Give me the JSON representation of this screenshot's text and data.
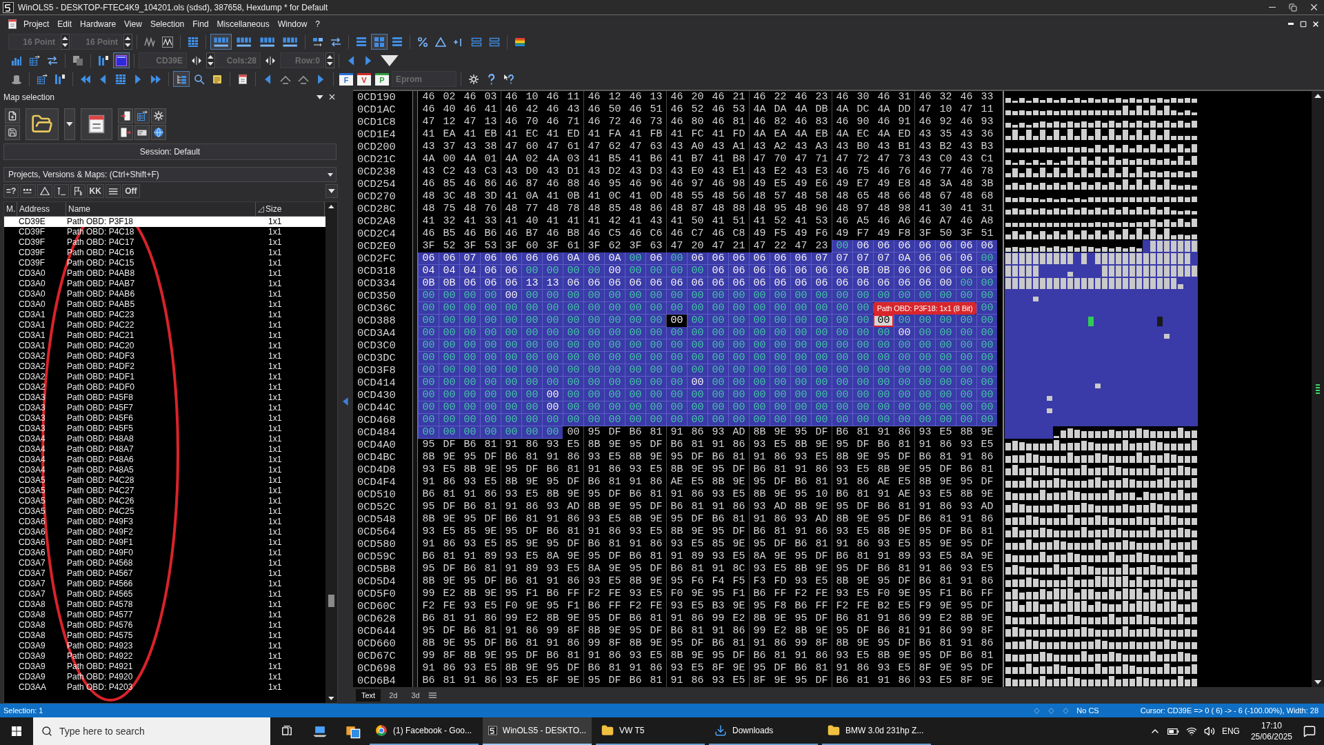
{
  "window": {
    "title": "WinOLS5 - DESKTOP-FTEC4K9_104201.ols (sdsd), 387658, Hexdump * for Default"
  },
  "menu": [
    "Project",
    "Edit",
    "Hardware",
    "View",
    "Selection",
    "Find",
    "Miscellaneous",
    "Window",
    "?"
  ],
  "toolbars": [
    [
      {
        "kind": "field",
        "value": "16 Point",
        "disabled": true
      },
      {
        "kind": "spin"
      },
      {
        "kind": "field",
        "value": "16 Point",
        "disabled": true
      },
      {
        "kind": "spin"
      },
      {
        "kind": "separator"
      },
      {
        "kind": "button",
        "pressed": false
      },
      {
        "kind": "button",
        "pressed": false
      },
      {
        "kind": "separator"
      },
      {
        "kind": "button",
        "pressed": false
      },
      {
        "kind": "separator"
      },
      {
        "kind": "button",
        "pressed": true
      },
      {
        "kind": "button",
        "pressed": false
      },
      {
        "kind": "button",
        "pressed": false
      },
      {
        "kind": "button",
        "pressed": false
      },
      {
        "kind": "separator"
      },
      {
        "kind": "button",
        "pressed": false
      },
      {
        "kind": "button",
        "pressed": false
      },
      {
        "kind": "separator"
      },
      {
        "kind": "button",
        "pressed": false
      },
      {
        "kind": "button",
        "pressed": true
      },
      {
        "kind": "button",
        "pressed": false
      },
      {
        "kind": "separator"
      },
      {
        "kind": "button",
        "pressed": false
      },
      {
        "kind": "button",
        "pressed": false
      },
      {
        "kind": "button",
        "pressed": false
      },
      {
        "kind": "button",
        "pressed": false
      },
      {
        "kind": "button",
        "pressed": false
      },
      {
        "kind": "separator"
      },
      {
        "kind": "button",
        "pressed": false
      }
    ],
    [
      {
        "kind": "button",
        "pressed": false
      },
      {
        "kind": "button",
        "pressed": false
      },
      {
        "kind": "button",
        "pressed": false
      },
      {
        "kind": "separator"
      },
      {
        "kind": "button",
        "pressed": false
      },
      {
        "kind": "separator"
      },
      {
        "kind": "button",
        "pressed": false
      },
      {
        "kind": "button",
        "pressed": true
      },
      {
        "kind": "separator"
      },
      {
        "kind": "field",
        "value": "CD39E",
        "disabled": true
      },
      {
        "kind": "button",
        "pressed": false
      },
      {
        "kind": "spin"
      },
      {
        "kind": "field",
        "value": "Cols:28",
        "disabled": true
      },
      {
        "kind": "button",
        "pressed": false
      },
      {
        "kind": "field",
        "value": "Row:0",
        "disabled": true
      },
      {
        "kind": "spin"
      },
      {
        "kind": "separator"
      },
      {
        "kind": "button",
        "pressed": false
      },
      {
        "kind": "button",
        "pressed": false
      },
      {
        "kind": "button",
        "pressed": false
      }
    ],
    [
      {
        "kind": "button",
        "pressed": false
      },
      {
        "kind": "separator"
      },
      {
        "kind": "button",
        "pressed": false
      },
      {
        "kind": "button",
        "pressed": false
      },
      {
        "kind": "separator"
      },
      {
        "kind": "button",
        "pressed": false
      },
      {
        "kind": "button",
        "pressed": false
      },
      {
        "kind": "button",
        "pressed": false
      },
      {
        "kind": "button",
        "pressed": false
      },
      {
        "kind": "button",
        "pressed": false
      },
      {
        "kind": "separator"
      },
      {
        "kind": "button",
        "pressed": true
      },
      {
        "kind": "button",
        "pressed": false
      },
      {
        "kind": "button",
        "pressed": false
      },
      {
        "kind": "separator"
      },
      {
        "kind": "button",
        "pressed": false
      },
      {
        "kind": "separator"
      },
      {
        "kind": "button",
        "pressed": false
      },
      {
        "kind": "button",
        "pressed": false
      },
      {
        "kind": "button",
        "pressed": false
      },
      {
        "kind": "button",
        "pressed": false
      },
      {
        "kind": "separator"
      },
      {
        "kind": "letter",
        "label": "F",
        "color": "#2a6fd6"
      },
      {
        "kind": "letter",
        "label": "V",
        "color": "#d42a2a"
      },
      {
        "kind": "letter",
        "label": "P",
        "color": "#2e9e3e"
      },
      {
        "kind": "field",
        "value": "Eprom",
        "disabled": true
      },
      {
        "kind": "separator"
      },
      {
        "kind": "button",
        "pressed": false
      },
      {
        "kind": "button",
        "pressed": false
      },
      {
        "kind": "button",
        "pressed": false
      }
    ]
  ],
  "map_selection": {
    "title": "Map selection",
    "session": "Session: Default",
    "filter": "Projects, Versions & Maps: (Ctrl+Shift+F)",
    "filter_buttons": [
      {
        "kind": "text",
        "label": "=?"
      },
      {
        "kind": "icon"
      },
      {
        "kind": "icon"
      },
      {
        "kind": "icon"
      },
      {
        "kind": "icon"
      },
      {
        "kind": "text",
        "label": "KK"
      },
      {
        "kind": "icon"
      },
      {
        "kind": "text",
        "label": "Off"
      }
    ],
    "columns": [
      {
        "label": "M.",
        "sorted": false
      },
      {
        "label": "Address",
        "sorted": false
      },
      {
        "label": "Name",
        "sorted": false
      },
      {
        "label": "Size",
        "sorted": true
      }
    ],
    "rows": [
      {
        "address": "CD39E",
        "name": "Path OBD: P3F18",
        "size": "1x1",
        "selected": true
      },
      {
        "address": "CD39F",
        "name": "Path OBD: P4C18",
        "size": "1x1",
        "selected": false
      },
      {
        "address": "CD39F",
        "name": "Path OBD: P4C17",
        "size": "1x1",
        "selected": false
      },
      {
        "address": "CD39F",
        "name": "Path OBD: P4C16",
        "size": "1x1",
        "selected": false
      },
      {
        "address": "CD39F",
        "name": "Path OBD: P4C15",
        "size": "1x1",
        "selected": false
      },
      {
        "address": "CD3A0",
        "name": "Path OBD: P4AB8",
        "size": "1x1",
        "selected": false
      },
      {
        "address": "CD3A0",
        "name": "Path OBD: P4AB7",
        "size": "1x1",
        "selected": false
      },
      {
        "address": "CD3A0",
        "name": "Path OBD: P4AB6",
        "size": "1x1",
        "selected": false
      },
      {
        "address": "CD3A0",
        "name": "Path OBD: P4AB5",
        "size": "1x1",
        "selected": false
      },
      {
        "address": "CD3A1",
        "name": "Path OBD: P4C23",
        "size": "1x1",
        "selected": false
      },
      {
        "address": "CD3A1",
        "name": "Path OBD: P4C22",
        "size": "1x1",
        "selected": false
      },
      {
        "address": "CD3A1",
        "name": "Path OBD: P4C21",
        "size": "1x1",
        "selected": false
      },
      {
        "address": "CD3A1",
        "name": "Path OBD: P4C20",
        "size": "1x1",
        "selected": false
      },
      {
        "address": "CD3A2",
        "name": "Path OBD: P4DF3",
        "size": "1x1",
        "selected": false
      },
      {
        "address": "CD3A2",
        "name": "Path OBD: P4DF2",
        "size": "1x1",
        "selected": false
      },
      {
        "address": "CD3A2",
        "name": "Path OBD: P4DF1",
        "size": "1x1",
        "selected": false
      },
      {
        "address": "CD3A2",
        "name": "Path OBD: P4DF0",
        "size": "1x1",
        "selected": false
      },
      {
        "address": "CD3A3",
        "name": "Path OBD: P45F8",
        "size": "1x1",
        "selected": false
      },
      {
        "address": "CD3A3",
        "name": "Path OBD: P45F7",
        "size": "1x1",
        "selected": false
      },
      {
        "address": "CD3A3",
        "name": "Path OBD: P45F6",
        "size": "1x1",
        "selected": false
      },
      {
        "address": "CD3A3",
        "name": "Path OBD: P45F5",
        "size": "1x1",
        "selected": false
      },
      {
        "address": "CD3A4",
        "name": "Path OBD: P48A8",
        "size": "1x1",
        "selected": false
      },
      {
        "address": "CD3A4",
        "name": "Path OBD: P48A7",
        "size": "1x1",
        "selected": false
      },
      {
        "address": "CD3A4",
        "name": "Path OBD: P48A6",
        "size": "1x1",
        "selected": false
      },
      {
        "address": "CD3A4",
        "name": "Path OBD: P48A5",
        "size": "1x1",
        "selected": false
      },
      {
        "address": "CD3A5",
        "name": "Path OBD: P4C28",
        "size": "1x1",
        "selected": false
      },
      {
        "address": "CD3A5",
        "name": "Path OBD: P4C27",
        "size": "1x1",
        "selected": false
      },
      {
        "address": "CD3A5",
        "name": "Path OBD: P4C26",
        "size": "1x1",
        "selected": false
      },
      {
        "address": "CD3A5",
        "name": "Path OBD: P4C25",
        "size": "1x1",
        "selected": false
      },
      {
        "address": "CD3A6",
        "name": "Path OBD: P49F3",
        "size": "1x1",
        "selected": false
      },
      {
        "address": "CD3A6",
        "name": "Path OBD: P49F2",
        "size": "1x1",
        "selected": false
      },
      {
        "address": "CD3A6",
        "name": "Path OBD: P49F1",
        "size": "1x1",
        "selected": false
      },
      {
        "address": "CD3A6",
        "name": "Path OBD: P49F0",
        "size": "1x1",
        "selected": false
      },
      {
        "address": "CD3A7",
        "name": "Path OBD: P4568",
        "size": "1x1",
        "selected": false
      },
      {
        "address": "CD3A7",
        "name": "Path OBD: P4567",
        "size": "1x1",
        "selected": false
      },
      {
        "address": "CD3A7",
        "name": "Path OBD: P4566",
        "size": "1x1",
        "selected": false
      },
      {
        "address": "CD3A7",
        "name": "Path OBD: P4565",
        "size": "1x1",
        "selected": false
      },
      {
        "address": "CD3A8",
        "name": "Path OBD: P4578",
        "size": "1x1",
        "selected": false
      },
      {
        "address": "CD3A8",
        "name": "Path OBD: P4577",
        "size": "1x1",
        "selected": false
      },
      {
        "address": "CD3A8",
        "name": "Path OBD: P4576",
        "size": "1x1",
        "selected": false
      },
      {
        "address": "CD3A8",
        "name": "Path OBD: P4575",
        "size": "1x1",
        "selected": false
      },
      {
        "address": "CD3A9",
        "name": "Path OBD: P4923",
        "size": "1x1",
        "selected": false
      },
      {
        "address": "CD3A9",
        "name": "Path OBD: P4922",
        "size": "1x1",
        "selected": false
      },
      {
        "address": "CD3A9",
        "name": "Path OBD: P4921",
        "size": "1x1",
        "selected": false
      },
      {
        "address": "CD3A9",
        "name": "Path OBD: P4920",
        "size": "1x1",
        "selected": false
      },
      {
        "address": "CD3AA",
        "name": "Path OBD: P4203",
        "size": "1x1",
        "selected": false
      }
    ]
  },
  "hexdump": {
    "rows": [
      {
        "address": "0CD190",
        "segments": [
          {
            "kind": "plain",
            "bytes": "46 02 46 03 46 10 46 11 46 12 46 13 46 20 46 21 46 22 46 23 46 30 46 31 46 32 46 33"
          }
        ]
      },
      {
        "address": "0CD1AC",
        "segments": [
          {
            "kind": "plain",
            "bytes": "46 40 46 41 46 42 46 43 46 50 46 51 46 52 46 53 4A DA 4A DB 4A DC 4A DD 47 10 47 11"
          }
        ]
      },
      {
        "address": "0CD1C8",
        "segments": [
          {
            "kind": "plain",
            "bytes": "47 12 47 13 46 70 46 71 46 72 46 73 46 80 46 81 46 82 46 83 46 90 46 91 46 92 46 93"
          }
        ]
      },
      {
        "address": "0CD1E4",
        "segments": [
          {
            "kind": "plain",
            "bytes": "41 EA 41 EB 41 EC 41 ED 41 FA 41 FB 41 FC 41 FD 4A EA 4A EB 4A EC 4A ED 43 35 43 36"
          }
        ]
      },
      {
        "address": "0CD200",
        "segments": [
          {
            "kind": "plain",
            "bytes": "43 37 43 38 47 60 47 61 47 62 47 63 43 A0 43 A1 43 A2 43 A3 43 B0 43 B1 43 B2 43 B3"
          }
        ]
      },
      {
        "address": "0CD21C",
        "segments": [
          {
            "kind": "plain",
            "bytes": "4A 00 4A 01 4A 02 4A 03 41 B5 41 B6 41 B7 41 B8 47 70 47 71 47 72 47 73 43 C0 43 C1"
          }
        ]
      },
      {
        "address": "0CD238",
        "segments": [
          {
            "kind": "plain",
            "bytes": "43 C2 43 C3 43 D0 43 D1 43 D2 43 D3 43 E0 43 E1 43 E2 43 E3 46 75 46 76 46 77 46 78"
          }
        ]
      },
      {
        "address": "0CD254",
        "segments": [
          {
            "kind": "plain",
            "bytes": "46 85 46 86 46 87 46 88 46 95 46 96 46 97 46 98 49 E5 49 E6 49 E7 49 E8 48 3A 48 3B"
          }
        ]
      },
      {
        "address": "0CD270",
        "segments": [
          {
            "kind": "plain",
            "bytes": "48 3C 48 3D 41 0A 41 0B 41 0C 41 0D 48 55 48 56 48 57 48 58 48 65 48 66 48 67 48 68"
          }
        ]
      },
      {
        "address": "0CD28C",
        "segments": [
          {
            "kind": "plain",
            "bytes": "48 75 48 76 48 77 48 78 48 85 48 86 48 87 48 88 48 95 48 96 48 97 48 98 41 30 41 31"
          }
        ]
      },
      {
        "address": "0CD2A8",
        "segments": [
          {
            "kind": "plain",
            "bytes": "41 32 41 33 41 40 41 41 41 42 41 43 41 50 41 51 41 52 41 53 46 A5 46 A6 46 A7 46 A8"
          }
        ]
      },
      {
        "address": "0CD2C4",
        "segments": [
          {
            "kind": "plain",
            "bytes": "46 B5 46 B6 46 B7 46 B8 46 C5 46 C6 46 C7 46 C8 49 F5 49 F6 49 F7 49 F8 3F 50 3F 51"
          }
        ]
      },
      {
        "address": "0CD2E0",
        "segments": [
          {
            "kind": "plain",
            "bytes": "3F 52 3F 53 3F 60 3F 61 3F 62 3F 63 47 20 47 21 47 22 47 23"
          },
          {
            "kind": "map-zero",
            "bytes": "00"
          },
          {
            "kind": "map",
            "bytes": "06 06 06 06 06 06 06"
          }
        ]
      },
      {
        "address": "0CD2FC",
        "segments": [
          {
            "kind": "map",
            "bytes": "06 06 07 06 06 06 06 0A 06 0A"
          },
          {
            "kind": "map-zero",
            "bytes": "00"
          },
          {
            "kind": "map",
            "bytes": "06"
          },
          {
            "kind": "map-zero",
            "bytes": "00"
          },
          {
            "kind": "map",
            "bytes": "06 06 06 06 06 06 07 07 07 07 0A 06 06 06"
          },
          {
            "kind": "map-zero",
            "bytes": "00"
          }
        ]
      },
      {
        "address": "0CD318",
        "segments": [
          {
            "kind": "map",
            "bytes": "04 04 04 06 06"
          },
          {
            "kind": "map-zero",
            "bytes": "00 00 00 00"
          },
          {
            "kind": "map",
            "bytes": "00"
          },
          {
            "kind": "map-zero",
            "bytes": "00 00 00 00"
          },
          {
            "kind": "map",
            "bytes": "06 06 06 06 06 06 06 0B 0B 06 06 06 06 06"
          }
        ]
      },
      {
        "address": "0CD334",
        "segments": [
          {
            "kind": "map",
            "bytes": "0B 0B 06 06 06 13 13 06 06 06 06 06 06 06 06 06 06 06 06 06 06 06 06 06 06 00"
          },
          {
            "kind": "map-zero",
            "bytes": "00 00"
          }
        ]
      },
      {
        "address": "0CD350",
        "segments": [
          {
            "kind": "map-zero",
            "bytes": "00 00 00 00"
          },
          {
            "kind": "map",
            "bytes": "00"
          },
          {
            "kind": "map-zero",
            "bytes": "00 00 00 00 00 00 00 00 00 00 00 00 00 00 00 00 00 00 00 00 00 00 00"
          }
        ]
      },
      {
        "address": "0CD36C",
        "segments": [
          {
            "kind": "map-zero",
            "bytes": "00 00 00 00 00 00 00 00 00 00 00 00 00 00 00 00 00 00 00 00 00 00"
          },
          {
            "kind": "tooltip",
            "text": "Path OBD: P3F18: 1x1 (8 Bit)"
          },
          {
            "kind": "map-zero",
            "bytes": "00"
          }
        ]
      },
      {
        "address": "0CD388",
        "segments": [
          {
            "kind": "map-zero",
            "bytes": "00 00 00 00 00 00 00 00 00 00 00 00"
          },
          {
            "kind": "marked",
            "bytes": "00"
          },
          {
            "kind": "map-zero",
            "bytes": "00 00 00 00 00 00 00 00 00"
          },
          {
            "kind": "cursor",
            "bytes": "00"
          },
          {
            "kind": "map-zero",
            "bytes": "00 00 00 00 00"
          }
        ]
      },
      {
        "address": "0CD3A4",
        "segments": [
          {
            "kind": "map-zero",
            "bytes": "00 00 00 00 00 00 00 00 00 00 00 00 00 00 00 00 00 00 00 00 00 00 00"
          },
          {
            "kind": "map",
            "bytes": "00"
          },
          {
            "kind": "map-zero",
            "bytes": "00 00 00 00"
          }
        ]
      },
      {
        "address": "0CD3C0",
        "segments": [
          {
            "kind": "map-zero",
            "bytes": "00 00 00 00 00 00 00 00 00 00 00 00 00 00 00 00 00 00 00 00 00 00 00 00 00 00 00 00"
          }
        ]
      },
      {
        "address": "0CD3DC",
        "segments": [
          {
            "kind": "map-zero",
            "bytes": "00 00 00 00 00 00 00 00 00 00 00 00 00 00 00 00 00 00 00 00 00 00 00 00 00 00 00 00"
          }
        ]
      },
      {
        "address": "0CD3F8",
        "segments": [
          {
            "kind": "map-zero",
            "bytes": "00 00 00 00 00 00 00 00 00 00 00 00 00 00 00 00 00 00 00 00 00 00 00 00 00 00 00 00"
          }
        ]
      },
      {
        "address": "0CD414",
        "segments": [
          {
            "kind": "map-zero",
            "bytes": "00 00 00 00 00 00 00 00 00 00 00 00 00"
          },
          {
            "kind": "map",
            "bytes": "00"
          },
          {
            "kind": "map-zero",
            "bytes": "00 00 00 00 00 00 00 00 00 00 00 00 00 00"
          }
        ]
      },
      {
        "address": "0CD430",
        "segments": [
          {
            "kind": "map-zero",
            "bytes": "00 00 00 00 00 00"
          },
          {
            "kind": "map",
            "bytes": "00"
          },
          {
            "kind": "map-zero",
            "bytes": "00 00 00 00 00 00 00 00 00 00 00 00 00 00 00 00 00 00 00 00 00"
          }
        ]
      },
      {
        "address": "0CD44C",
        "segments": [
          {
            "kind": "map-zero",
            "bytes": "00 00 00 00 00 00"
          },
          {
            "kind": "map",
            "bytes": "00"
          },
          {
            "kind": "map-zero",
            "bytes": "00 00 00 00 00 00 00 00 00 00 00 00 00 00 00 00 00 00 00 00 00"
          }
        ]
      },
      {
        "address": "0CD468",
        "segments": [
          {
            "kind": "map-zero",
            "bytes": "00 00 00 00 00 00 00 00 00 00 00 00 00 00 00 00 00 00 00 00 00 00 00 00 00 00 00 00"
          }
        ]
      },
      {
        "address": "0CD484",
        "segments": [
          {
            "kind": "map-zero",
            "bytes": "00 00 00 00 00 00 00"
          },
          {
            "kind": "plain",
            "bytes": "00 95 DF B6 81 91 86 93 AD 8B 9E 95 DF B6 81 91 86 93 E5 8B 9E"
          }
        ]
      },
      {
        "address": "0CD4A0",
        "segments": [
          {
            "kind": "plain",
            "bytes": "95 DF B6 81 91 86 93 E5 8B 9E 95 DF B6 81 91 86 93 E5 8B 9E 95 DF B6 81 91 86 93 E5"
          }
        ]
      },
      {
        "address": "0CD4BC",
        "segments": [
          {
            "kind": "plain",
            "bytes": "8B 9E 95 DF B6 81 91 86 93 E5 8B 9E 95 DF B6 81 91 86 93 E5 8B 9E 95 DF B6 81 91 86"
          }
        ]
      },
      {
        "address": "0CD4D8",
        "segments": [
          {
            "kind": "plain",
            "bytes": "93 E5 8B 9E 95 DF B6 81 91 86 93 E5 8B 9E 95 DF B6 81 91 86 93 E5 8B 9E 95 DF B6 81"
          }
        ]
      },
      {
        "address": "0CD4F4",
        "segments": [
          {
            "kind": "plain",
            "bytes": "91 86 93 E5 8B 9E 95 DF B6 81 91 86 AE E5 8B 9E 95 DF B6 81 91 86 AE E5 8B 9E 95 DF"
          }
        ]
      },
      {
        "address": "0CD510",
        "segments": [
          {
            "kind": "plain",
            "bytes": "B6 81 91 86 93 E5 8B 9E 95 DF B6 81 91 86 93 E5 8B 9E 95 10 B6 81 91 AE 93 E5 8B 9E"
          }
        ]
      },
      {
        "address": "0CD52C",
        "segments": [
          {
            "kind": "plain",
            "bytes": "95 DF B6 81 91 86 93 AD 8B 9E 95 DF B6 81 91 86 93 AD 8B 9E 95 DF B6 81 91 86 93 AD"
          }
        ]
      },
      {
        "address": "0CD548",
        "segments": [
          {
            "kind": "plain",
            "bytes": "8B 9E 95 DF B6 81 91 86 93 E5 8B 9E 95 DF B6 81 91 86 93 AD 8B 9E 95 DF B6 81 91 86"
          }
        ]
      },
      {
        "address": "0CD564",
        "segments": [
          {
            "kind": "plain",
            "bytes": "93 E5 85 9E 95 DF B6 81 91 86 93 E5 8B 9E 95 DF B6 81 91 86 93 E5 8B 9E 95 DF B6 81"
          }
        ]
      },
      {
        "address": "0CD580",
        "segments": [
          {
            "kind": "plain",
            "bytes": "91 86 93 E5 85 9E 95 DF B6 81 91 86 93 E5 85 9E 95 DF B6 81 91 86 93 E5 85 9E 95 DF"
          }
        ]
      },
      {
        "address": "0CD59C",
        "segments": [
          {
            "kind": "plain",
            "bytes": "B6 81 91 89 93 E5 8A 9E 95 DF B6 81 91 89 93 E5 8A 9E 95 DF B6 81 91 89 93 E5 8A 9E"
          }
        ]
      },
      {
        "address": "0CD5B8",
        "segments": [
          {
            "kind": "plain",
            "bytes": "95 DF B6 81 91 89 93 E5 8A 9E 95 DF B6 81 91 8C 93 E5 8B 9E 95 DF B6 81 91 86 93 E5"
          }
        ]
      },
      {
        "address": "0CD5D4",
        "segments": [
          {
            "kind": "plain",
            "bytes": "8B 9E 95 DF B6 81 91 86 93 E5 8B 9E 95 F6 F4 F5 F3 FD 93 E5 8B 9E 95 DF B6 81 91 86"
          }
        ]
      },
      {
        "address": "0CD5F0",
        "segments": [
          {
            "kind": "plain",
            "bytes": "99 E2 8B 9E 95 F1 B6 FF F2 FE 93 E5 F0 9E 95 F1 B6 FF F2 FE 93 E5 F0 9E 95 F1 B6 FF"
          }
        ]
      },
      {
        "address": "0CD60C",
        "segments": [
          {
            "kind": "plain",
            "bytes": "F2 FE 93 E5 F0 9E 95 F1 B6 FF F2 FE 93 E5 B3 9E 95 F8 B6 FF F2 FE B2 E5 F9 9E 95 DF"
          }
        ]
      },
      {
        "address": "0CD628",
        "segments": [
          {
            "kind": "plain",
            "bytes": "B6 81 91 86 99 E2 8B 9E 95 DF B6 81 91 86 99 E2 8B 9E 95 DF B6 81 91 86 99 E2 8B 9E"
          }
        ]
      },
      {
        "address": "0CD644",
        "segments": [
          {
            "kind": "plain",
            "bytes": "95 DF B6 81 91 86 99 8F 8B 9E 95 DF B6 81 91 86 99 E2 8B 9E 95 DF B6 81 91 86 99 8F"
          }
        ]
      },
      {
        "address": "0CD660",
        "segments": [
          {
            "kind": "plain",
            "bytes": "8B 9E 95 DF B6 81 91 86 99 8F 8B 9E 95 DF B6 81 91 86 99 8F 8B 9E 95 DF B6 81 91 86"
          }
        ]
      },
      {
        "address": "0CD67C",
        "segments": [
          {
            "kind": "plain",
            "bytes": "99 8F 8B 9E 95 DF B6 81 91 86 93 E5 8B 9E 95 DF B6 81 91 86 93 E5 8B 9E 95 DF B6 81"
          }
        ]
      },
      {
        "address": "0CD698",
        "segments": [
          {
            "kind": "plain",
            "bytes": "91 86 93 E5 8B 9E 95 DF B6 81 91 86 93 E5 8F 9E 95 DF B6 81 91 86 93 E5 8F 9E 95 DF"
          }
        ]
      },
      {
        "address": "0CD6B4",
        "segments": [
          {
            "kind": "plain",
            "bytes": "B6 81 91 86 93 E5 8F 9E 95 DF B6 81 91 86 93 E5 8F 9E 95 DF B6 81 91 86 93 E5 8F 9E"
          }
        ]
      }
    ],
    "tabs": [
      {
        "label": "Text",
        "selected": true
      },
      {
        "label": "2d",
        "selected": false
      },
      {
        "label": "3d",
        "selected": false
      }
    ]
  },
  "status_bar": {
    "selection": "Selection: 1",
    "checksum": "No CS",
    "cursor": "Cursor: CD39E => 0 ( 6) -> - 6 (-100.00%), Width: 28"
  },
  "taskbar": {
    "search_placeholder": "Type here to search",
    "windows": [
      {
        "label": "(1) Facebook - Goo...",
        "active": false
      },
      {
        "label": "WinOLS5 - DESKTO...",
        "active": true
      },
      {
        "label": "VW T5",
        "active": false
      },
      {
        "label": "Downloads",
        "active": false
      },
      {
        "label": "BMW 3.0d 231hp Z...",
        "active": false
      }
    ],
    "language": "ENG",
    "time": "17:10",
    "date": "25/06/2025"
  }
}
